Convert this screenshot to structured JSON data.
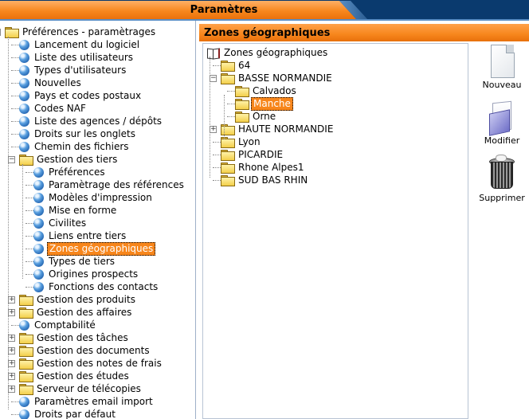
{
  "window": {
    "title": "Paramètres"
  },
  "left_tree": {
    "items": [
      {
        "label": "Préférences - paramètrages",
        "icon": "folder-open-icon",
        "level": 0,
        "expanded": true
      },
      {
        "label": "Lancement du logiciel",
        "icon": "bullet-icon",
        "level": 1
      },
      {
        "label": "Liste des utilisateurs",
        "icon": "bullet-icon",
        "level": 1
      },
      {
        "label": "Types d'utilisateurs",
        "icon": "bullet-icon",
        "level": 1
      },
      {
        "label": "Nouvelles",
        "icon": "bullet-icon",
        "level": 1
      },
      {
        "label": "Pays et codes postaux",
        "icon": "bullet-icon",
        "level": 1
      },
      {
        "label": "Codes NAF",
        "icon": "bullet-icon",
        "level": 1
      },
      {
        "label": "Liste des agences / dépôts",
        "icon": "bullet-icon",
        "level": 1
      },
      {
        "label": "Droits sur les onglets",
        "icon": "bullet-icon",
        "level": 1
      },
      {
        "label": "Chemin des fichiers",
        "icon": "bullet-icon",
        "level": 1
      },
      {
        "label": "Gestion des tiers",
        "icon": "folder-open-icon",
        "level": 1,
        "expanded": true
      },
      {
        "label": "Préférences",
        "icon": "bullet-icon",
        "level": 2
      },
      {
        "label": "Paramètrage des références",
        "icon": "bullet-icon",
        "level": 2
      },
      {
        "label": "Modèles d'impression",
        "icon": "bullet-icon",
        "level": 2
      },
      {
        "label": "Mise en forme",
        "icon": "bullet-icon",
        "level": 2
      },
      {
        "label": "Civilites",
        "icon": "bullet-icon",
        "level": 2
      },
      {
        "label": "Liens entre tiers",
        "icon": "bullet-icon",
        "level": 2
      },
      {
        "label": "Zones géographiques",
        "icon": "bullet-icon",
        "level": 2,
        "selected": true
      },
      {
        "label": "Types de tiers",
        "icon": "bullet-icon",
        "level": 2
      },
      {
        "label": "Origines prospects",
        "icon": "bullet-icon",
        "level": 2
      },
      {
        "label": "Fonctions des contacts",
        "icon": "bullet-icon",
        "level": 2
      },
      {
        "label": "Gestion des produits",
        "icon": "folder-icon",
        "level": 1,
        "collapsed": true
      },
      {
        "label": "Gestion des affaires",
        "icon": "folder-icon",
        "level": 1,
        "collapsed": true
      },
      {
        "label": "Comptabilité",
        "icon": "bullet-icon",
        "level": 1
      },
      {
        "label": "Gestion des tâches",
        "icon": "folder-icon",
        "level": 1,
        "collapsed": true
      },
      {
        "label": "Gestion des documents",
        "icon": "folder-icon",
        "level": 1,
        "collapsed": true
      },
      {
        "label": "Gestion des notes de frais",
        "icon": "folder-icon",
        "level": 1,
        "collapsed": true
      },
      {
        "label": "Gestion des études",
        "icon": "folder-icon",
        "level": 1,
        "collapsed": true
      },
      {
        "label": "Serveur de télécopies",
        "icon": "folder-icon",
        "level": 1,
        "collapsed": true
      },
      {
        "label": "Paramètres email import",
        "icon": "bullet-icon",
        "level": 1
      },
      {
        "label": "Droits par défaut",
        "icon": "bullet-icon",
        "level": 1
      }
    ]
  },
  "panel": {
    "title": "Zones géographiques",
    "tree": [
      {
        "label": "Zones géographiques",
        "icon": "book-icon",
        "level": 0
      },
      {
        "label": "64",
        "icon": "folder-icon",
        "level": 1
      },
      {
        "label": "BASSE NORMANDIE",
        "icon": "folder-open-icon",
        "level": 1,
        "expanded": true
      },
      {
        "label": "Calvados",
        "icon": "folder-icon",
        "level": 2
      },
      {
        "label": "Manche",
        "icon": "folder-icon",
        "level": 2,
        "selected": true
      },
      {
        "label": "Orne",
        "icon": "folder-icon",
        "level": 2
      },
      {
        "label": "HAUTE NORMANDIE",
        "icon": "folder-icon",
        "level": 1,
        "collapsed": true
      },
      {
        "label": "Lyon",
        "icon": "folder-icon",
        "level": 1
      },
      {
        "label": "PICARDIE",
        "icon": "folder-icon",
        "level": 1
      },
      {
        "label": "Rhone Alpes1",
        "icon": "folder-icon",
        "level": 1
      },
      {
        "label": "SUD BAS RHIN",
        "icon": "folder-icon",
        "level": 1
      }
    ]
  },
  "toolbar": {
    "new_label": "Nouveau",
    "edit_label": "Modifier",
    "delete_label": "Supprimer"
  },
  "colors": {
    "accent": "#f7861c",
    "titlebar_bg": "#0a3a6e"
  }
}
